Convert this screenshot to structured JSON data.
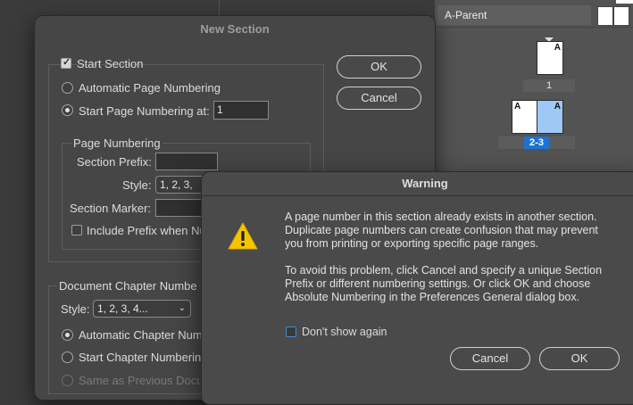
{
  "pages_panel": {
    "parent_label": "A-Parent",
    "page1_letter": "A",
    "page1_number": "1",
    "spread_left_letter": "A",
    "spread_right_letter": "A",
    "spread_number": "2-3",
    "colors": {
      "selected": "#1b74d2",
      "selected_page": "#9ec8f5"
    }
  },
  "new_section": {
    "title": "New Section",
    "start_section_label": "Start Section",
    "start_section_checked": true,
    "auto_page_label": "Automatic Page Numbering",
    "start_page_label": "Start Page Numbering at:",
    "start_page_value": "1",
    "page_numbering_group": "Page Numbering",
    "section_prefix_label": "Section Prefix:",
    "section_prefix_value": "",
    "style_label": "Style:",
    "style_value": "1, 2, 3,",
    "section_marker_label": "Section Marker:",
    "section_marker_value": "",
    "include_prefix_label": "Include Prefix when Nu",
    "ok_label": "OK",
    "cancel_label": "Cancel",
    "chapter_group": "Document Chapter Numbe",
    "chapter_style_label": "Style:",
    "chapter_style_value": "1, 2, 3, 4...",
    "auto_chapter_label": "Automatic Chapter Num",
    "start_chapter_label": "Start Chapter Numberin",
    "same_prev_label": "Same as Previous Docu"
  },
  "warning": {
    "title": "Warning",
    "paragraph1_line1": "A page number in this section already exists in another section.",
    "paragraph1_line2": "Duplicate page numbers can create confusion that may prevent",
    "paragraph1_line3": "you from printing or exporting specific page ranges.",
    "paragraph2_line1": "To avoid this problem, click Cancel and specify a unique Section",
    "paragraph2_line2": "Prefix or different numbering settings. Or click OK and choose",
    "paragraph2_line3": "Absolute Numbering in the Preferences General dialog box.",
    "dont_show_label": "Don't show again",
    "cancel_label": "Cancel",
    "ok_label": "OK",
    "icon": "warning-icon",
    "icon_color": "#f5c400"
  }
}
